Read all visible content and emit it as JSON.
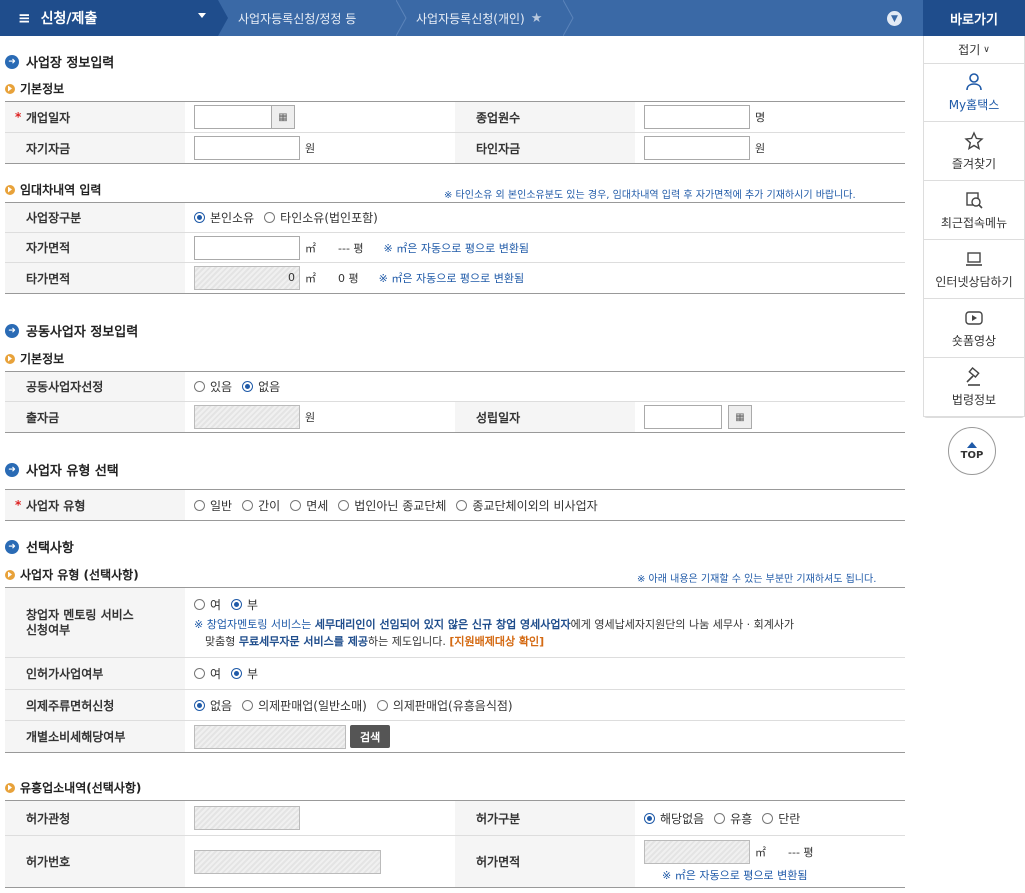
{
  "topbar": {
    "menu_label": "신청/제출",
    "crumb1": "사업자등록신청/정정 등",
    "crumb2": "사업자등록신청(개인)"
  },
  "quick": {
    "title": "바로가기",
    "fold": "접기",
    "items": [
      {
        "label": "My홈택스"
      },
      {
        "label": "즐겨찾기"
      },
      {
        "label": "최근접속메뉴"
      },
      {
        "label": "인터넷상담하기"
      },
      {
        "label": "숏폼영상"
      },
      {
        "label": "법령정보"
      }
    ],
    "top": "TOP"
  },
  "sec1": {
    "title": "사업장 정보입력",
    "basic_title": "기본정보",
    "open_date_label": "개업일자",
    "employees_label": "종업원수",
    "employees_unit": "명",
    "own_fund_label": "자기자금",
    "own_fund_unit": "원",
    "other_fund_label": "타인자금",
    "other_fund_unit": "원",
    "lease_title": "임대차내역 입력",
    "lease_note": "※ 타인소유 외 본인소유분도 있는 경우, 임대차내역 입력 후 자가면적에 추가 기재하시기 바랍니다.",
    "site_type_label": "사업장구분",
    "site_opt1": "본인소유",
    "site_opt2": "타인소유(법인포함)",
    "own_area_label": "자가면적",
    "area_unit": "㎡",
    "own_pyeong": "--- 평",
    "area_hint": "※ ㎡은 자동으로 평으로 변환됨",
    "other_area_label": "타가면적",
    "other_area_value": "0",
    "other_pyeong": "0 평"
  },
  "sec2": {
    "title": "공동사업자 정보입력",
    "basic_title": "기본정보",
    "joint_label": "공동사업자선정",
    "opt_yes": "있음",
    "opt_no": "없음",
    "invest_label": "출자금",
    "invest_unit": "원",
    "found_label": "성립일자"
  },
  "sec3": {
    "title": "사업자 유형 선택",
    "type_label": "사업자 유형",
    "types": [
      "일반",
      "간이",
      "면세",
      "법인아닌 종교단체",
      "종교단체이외의 비사업자"
    ]
  },
  "sec4": {
    "title": "선택사항",
    "sub_title": "사업자 유형 (선택사항)",
    "sub_note": "※ 아래 내용은 기재할 수 있는 부분만 기재하셔도 됩니다.",
    "mentor_label1": "창업자 멘토링 서비스",
    "mentor_label2": "신청여부",
    "opt_y": "여",
    "opt_n": "부",
    "mentor_desc1": "※ 창업자멘토링 서비스는",
    "mentor_desc2": "세무대리인이 선임되어 있지 않은 신규 창업 영세사업자",
    "mentor_desc3": "에게 영세납세자지원단의 나눔 세무사 · 회계사가",
    "mentor_desc4": "맞춤형",
    "mentor_desc5": "무료세무자문 서비스를 제공",
    "mentor_desc6": "하는 제도입니다.",
    "mentor_link": "[지원배제대상 확인]",
    "license_label": "인허가사업여부",
    "liquor_label": "의제주류면허신청",
    "liquor_opts": [
      "없음",
      "의제판매업(일반소매)",
      "의제판매업(유흥음식점)"
    ],
    "excise_label": "개별소비세해당여부",
    "search_btn": "검색"
  },
  "sec5": {
    "title": "유흥업소내역(선택사항)",
    "office_label": "허가관청",
    "kind_label": "허가구분",
    "kind_opts": [
      "해당없음",
      "유흥",
      "단란"
    ],
    "num_label": "허가번호",
    "area_label": "허가면적",
    "area_unit": "㎡",
    "pyeong": "--- 평",
    "area_hint": "※ ㎡은 자동으로 평으로 변환됨"
  }
}
